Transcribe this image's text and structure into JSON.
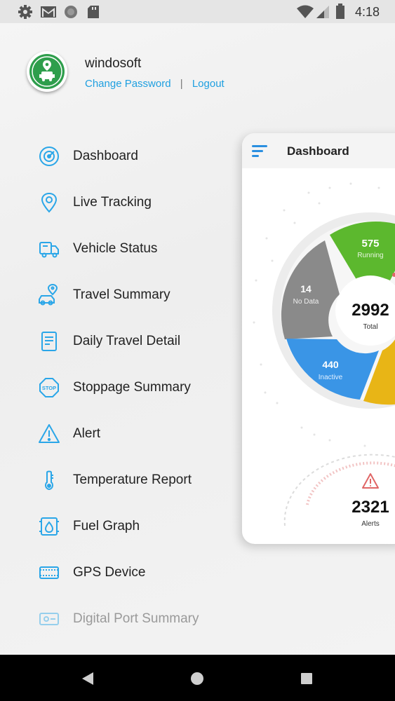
{
  "status_bar": {
    "time": "4:18",
    "left_icons": [
      "settings-icon",
      "gmail-icon",
      "circle-app-icon",
      "sd-card-icon"
    ],
    "right_icons": [
      "wifi-icon",
      "signal-icon",
      "battery-icon"
    ]
  },
  "profile": {
    "username": "windosoft",
    "change_password_label": "Change Password",
    "separator": "|",
    "logout_label": "Logout"
  },
  "menu": {
    "items": [
      {
        "label": "Dashboard",
        "icon": "dashboard-icon"
      },
      {
        "label": "Live Tracking",
        "icon": "location-pin-icon"
      },
      {
        "label": "Vehicle Status",
        "icon": "truck-icon"
      },
      {
        "label": "Travel Summary",
        "icon": "car-route-icon"
      },
      {
        "label": "Daily Travel Detail",
        "icon": "document-icon"
      },
      {
        "label": "Stoppage Summary",
        "icon": "stop-sign-icon"
      },
      {
        "label": "Alert",
        "icon": "warning-icon"
      },
      {
        "label": "Temperature Report",
        "icon": "thermometer-icon"
      },
      {
        "label": "Fuel Graph",
        "icon": "fuel-icon"
      },
      {
        "label": "GPS Device",
        "icon": "gps-device-icon"
      },
      {
        "label": "Digital Port Summary",
        "icon": "digital-port-icon"
      }
    ]
  },
  "dashboard_card": {
    "title": "Dashboard",
    "total_value": "2992",
    "total_label": "Total",
    "segments": [
      {
        "value": "575",
        "label": "Running",
        "color": "#5cb82e"
      },
      {
        "value": "14",
        "label": "No Data",
        "color": "#8a8a8a"
      },
      {
        "value": "440",
        "label": "Inactive",
        "color": "#3a95e6"
      },
      {
        "value": "",
        "label": "",
        "color": "#e8b516"
      }
    ],
    "alerts_value": "2321",
    "alerts_label": "Alerts"
  },
  "colors": {
    "accent": "#1e9fe0",
    "icon_blue": "#2aa6e8",
    "logo_green": "#2e9e4c",
    "alert_red": "#e06666"
  },
  "nav_bar": {
    "icons": [
      "back-icon",
      "home-icon",
      "recents-icon"
    ]
  }
}
